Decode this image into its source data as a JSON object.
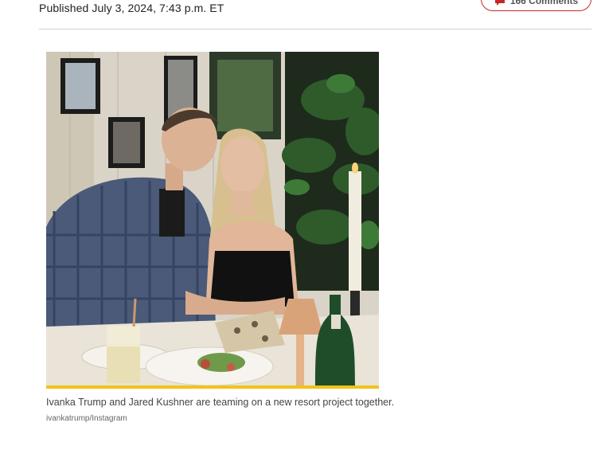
{
  "article": {
    "published": "Published July 3, 2024, 7:43 p.m. ET",
    "comments_label": "166 Comments",
    "comment_icon": "speech-bubble-icon",
    "accent_color": "#c62828"
  },
  "photo": {
    "caption": "Ivanka Trump and Jared Kushner are teaming on a new resort project together.",
    "credit": "ivankatrump/Instagram",
    "rule_color": "#f0c419"
  }
}
